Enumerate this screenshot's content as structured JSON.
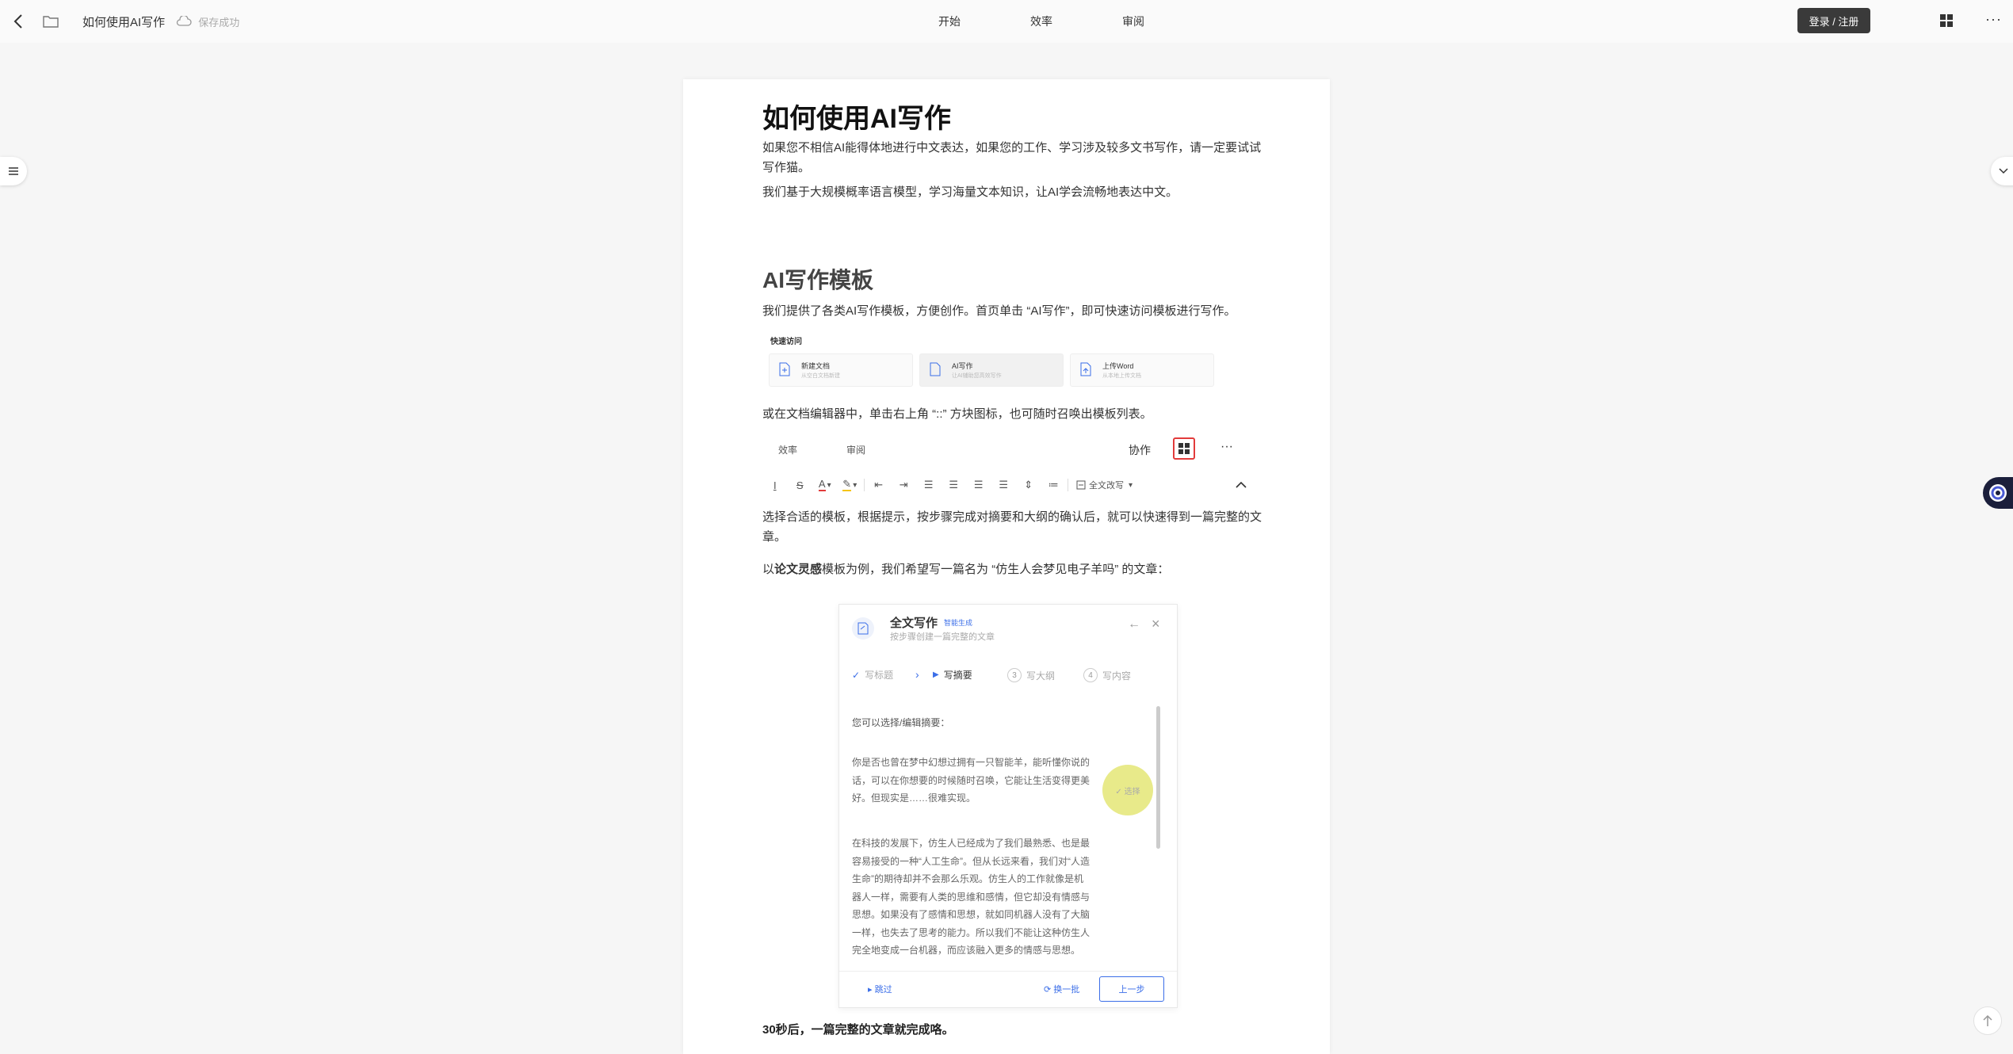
{
  "topbar": {
    "doc_title": "如何使用AI写作",
    "save_status": "保存成功",
    "tabs": [
      "开始",
      "效率",
      "审阅"
    ],
    "login_label": "登录 / 注册",
    "more_label": "···"
  },
  "doc": {
    "h1": "如何使用AI写作",
    "p1": "如果您不相信AI能得体地进行中文表达，如果您的工作、学习涉及较多文书写作，请一定要试试写作猫。",
    "p2": "我们基于大规模概率语言模型，学习海量文本知识，让AI学会流畅地表达中文。",
    "h2": "AI写作模板",
    "p3": "我们提供了各类AI写作模板，方便创作。首页单击 “AI写作”，即可快速访问模板进行写作。",
    "quick_access": {
      "title": "快速访问",
      "cards": [
        {
          "name": "新建文档",
          "sub": "从空白文档新建"
        },
        {
          "name": "AI写作",
          "sub": "让AI辅助您高效写作"
        },
        {
          "name": "上传Word",
          "sub": "从本地上传文档"
        }
      ]
    },
    "p4": "或在文档编辑器中，单击右上角 “::” 方块图标，也可随时召唤出模板列表。",
    "toolbar_image": {
      "tab1": "效率",
      "tab2": "审阅",
      "coop": "协作",
      "more": "···",
      "font_dropdown": "全文改写"
    },
    "p5": "选择合适的模板，根据提示，按步骤完成对摘要和大纲的确认后，就可以快速得到一篇完整的文章。",
    "p6_prefix": "以",
    "p6_bold": "论文灵感",
    "p6_suffix": "模板为例，我们希望写一篇名为 “仿生人会梦见电子羊吗” 的文章：",
    "modal": {
      "title": "全文写作",
      "badge": "智能生成",
      "subtitle": "按步骤创建一篇完整的文章",
      "steps": [
        {
          "num": "✓",
          "label": "写标题"
        },
        {
          "num": "▶",
          "label": "写摘要"
        },
        {
          "num": "3",
          "label": "写大纲"
        },
        {
          "num": "4",
          "label": "写内容"
        }
      ],
      "label": "您可以选择/编辑摘要：",
      "para1": "你是否也曾在梦中幻想过拥有一只智能羊，能听懂你说的话，可以在你想要的时候随时召唤，它能让生活变得更美好。但现实是……很难实现。",
      "para2": "在科技的发展下，仿生人已经成为了我们最熟悉、也是最容易接受的一种“人工生命”。但从长远来看，我们对“人造生命”的期待却并不会那么乐观。仿生人的工作就像是机器人一样，需要有人类的思维和感情，但它却没有情感与思想。如果没有了感情和思想，就如同机器人没有了大脑一样，也失去了思考的能力。所以我们不能让这种仿生人完全地变成一台机器，而应该融入更多的情感与思想。",
      "select_label": "✓ 选择",
      "skip": "▸ 跳过",
      "swap": "⟳ 换一批",
      "prev": "上一步"
    },
    "final": "30秒后，一篇完整的文章就完成咯。"
  },
  "colors": {
    "accent": "#3b6ee8",
    "highlight_border": "#e23b3b",
    "login_bg": "#3a3a3a"
  }
}
